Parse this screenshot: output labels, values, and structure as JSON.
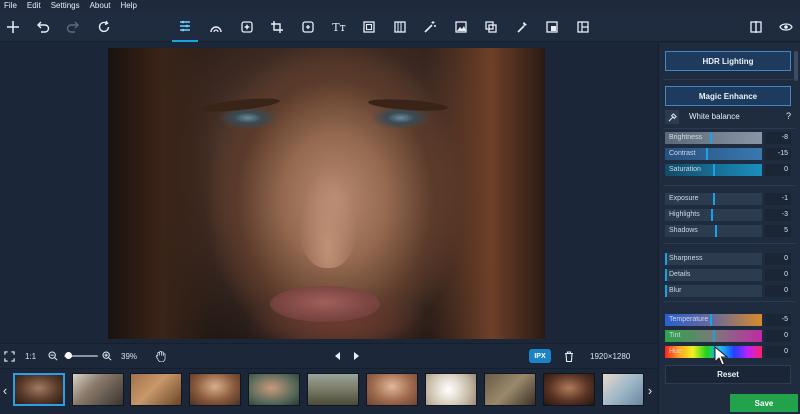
{
  "menu": [
    "File",
    "Edit",
    "Settings",
    "About",
    "Help"
  ],
  "toolbar": {
    "left_icons": [
      "plus-icon",
      "undo-icon",
      "redo-icon",
      "reset-icon"
    ],
    "tools": [
      "adjust-tool-icon",
      "retouch-tool-icon",
      "enhance-tool-icon",
      "crop-tool-icon",
      "transform-tool-icon",
      "text-tool-icon",
      "frame-tool-icon",
      "filter-tool-icon",
      "magic-wand-icon",
      "image-tool-icon",
      "layers-tool-icon",
      "brush-tool-icon",
      "background-tool-icon",
      "collage-tool-icon"
    ],
    "right_icons": [
      "compare-icon",
      "preview-eye-icon"
    ],
    "active_tool": "adjust-tool-icon"
  },
  "controls": {
    "ratio_label": "1:1",
    "zoom_value": "39%",
    "zoom_fraction": 0.12,
    "badge_label": "IPX",
    "dimensions": "1920×1280"
  },
  "filmstrip": {
    "thumb_count": 11,
    "selected_index": 0
  },
  "panel": {
    "hdr_label": "HDR Lighting",
    "magic_label": "Magic Enhance",
    "white_balance_label": "White balance",
    "help_label": "?",
    "reset_label": "Reset",
    "sliders": [
      {
        "label": "Brightness",
        "value": "-8",
        "level": 0.47,
        "style": "gray"
      },
      {
        "label": "Contrast",
        "value": "-15",
        "level": 0.43,
        "style": "blue"
      },
      {
        "label": "Saturation",
        "value": "0",
        "level": 0.5,
        "style": "teal"
      },
      {
        "label": "Exposure",
        "value": "-1",
        "level": 0.5,
        "style": "plain"
      },
      {
        "label": "Highlights",
        "value": "-3",
        "level": 0.48,
        "style": "plain"
      },
      {
        "label": "Shadows",
        "value": "5",
        "level": 0.53,
        "style": "plain"
      },
      {
        "label": "Sharpness",
        "value": "0",
        "level": 0.0,
        "style": "plain"
      },
      {
        "label": "Details",
        "value": "0",
        "level": 0.0,
        "style": "plain"
      },
      {
        "label": "Blur",
        "value": "0",
        "level": 0.0,
        "style": "plain"
      },
      {
        "label": "Temperature",
        "value": "-5",
        "level": 0.47,
        "style": "temperature"
      },
      {
        "label": "Tint",
        "value": "0",
        "level": 0.5,
        "style": "tint"
      },
      {
        "label": "Hue",
        "value": "0",
        "level": 0.5,
        "style": "hue"
      }
    ]
  },
  "save_label": "Save",
  "colors": {
    "accent": "#19a3e0",
    "save": "#22a24a",
    "panel_bg": "#1f2c3f",
    "app_bg": "#1b2638"
  }
}
